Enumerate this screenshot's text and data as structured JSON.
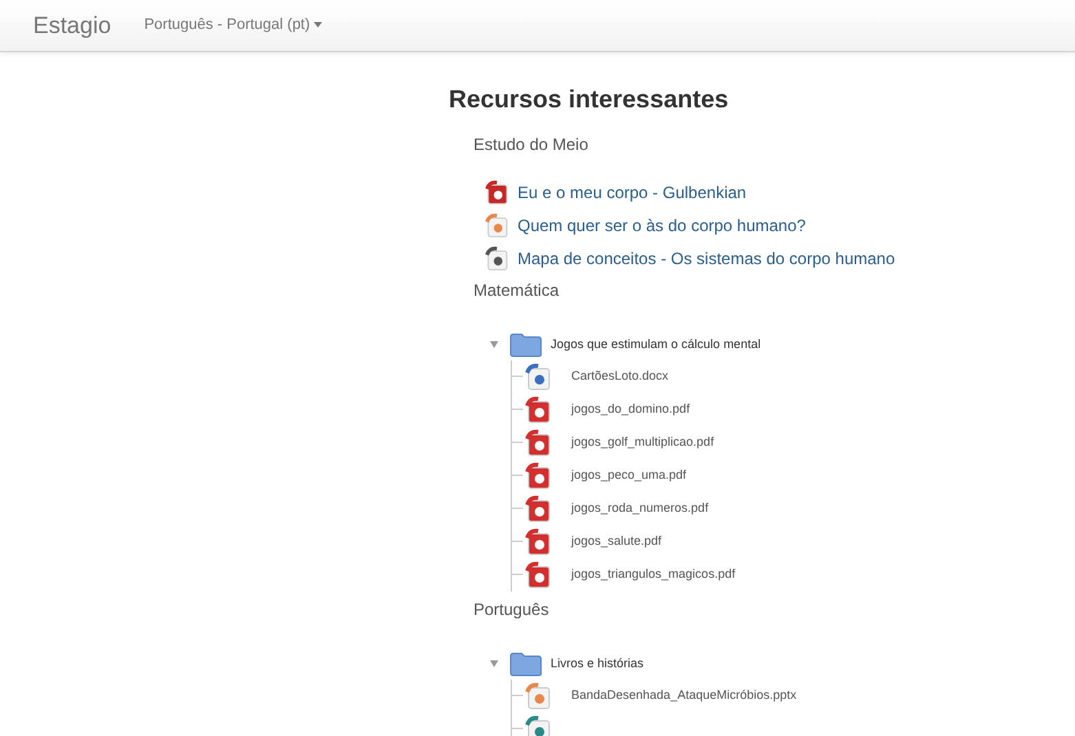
{
  "navbar": {
    "brand": "Estagio",
    "language": "Português - Portugal (pt)"
  },
  "page_title": "Recursos interessantes",
  "sections": [
    {
      "title": "Estudo do Meio",
      "resources": [
        {
          "kind": "video",
          "label": "Eu e o meu corpo - Gulbenkian"
        },
        {
          "kind": "presentation",
          "label": "Quem quer ser o às do corpo humano?"
        },
        {
          "kind": "link",
          "label": "Mapa de conceitos - Os sistemas do corpo humano"
        }
      ]
    },
    {
      "title": "Matemática",
      "folder": {
        "name": "Jogos que estimulam o cálculo mental",
        "expanded": true,
        "files": [
          {
            "kind": "word",
            "name": "CartõesLoto.docx"
          },
          {
            "kind": "pdf",
            "name": "jogos_do_domino.pdf"
          },
          {
            "kind": "pdf",
            "name": "jogos_golf_multiplicao.pdf"
          },
          {
            "kind": "pdf",
            "name": "jogos_peco_uma.pdf"
          },
          {
            "kind": "pdf",
            "name": "jogos_roda_numeros.pdf"
          },
          {
            "kind": "pdf",
            "name": "jogos_salute.pdf"
          },
          {
            "kind": "pdf",
            "name": "jogos_triangulos_magicos.pdf"
          }
        ]
      }
    },
    {
      "title": "Português",
      "folder": {
        "name": "Livros e histórias",
        "expanded": true,
        "files": [
          {
            "kind": "presentation",
            "name": "BandaDesenhada_AtaqueMicróbios.pptx"
          },
          {
            "kind": "audio"
          }
        ]
      }
    }
  ]
}
